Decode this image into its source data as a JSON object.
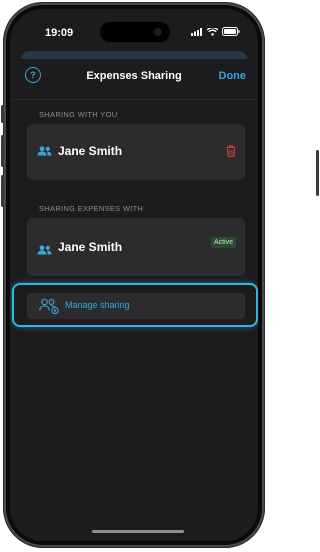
{
  "status_bar": {
    "time": "19:09"
  },
  "nav": {
    "title": "Expenses Sharing",
    "help_icon_glyph": "?",
    "done_label": "Done"
  },
  "sections": {
    "sharing_with_you": {
      "label": "SHARING WITH YOU",
      "name": "Jane Smith"
    },
    "sharing_expenses_with": {
      "label": "SHARING EXPENSES WITH",
      "name": "Jane Smith",
      "status": "Active"
    }
  },
  "manage": {
    "label": "Manage sharing"
  },
  "colors": {
    "accent": "#3aa6dd",
    "danger": "#d9413c",
    "background": "#1c1c1e",
    "card": "#2c2c2e",
    "badge_bg": "#2d4a2d"
  },
  "icons": {
    "help": "help-circle-icon",
    "people": "people-icon",
    "trash": "trash-icon",
    "manage": "manage-sharing-icon"
  }
}
